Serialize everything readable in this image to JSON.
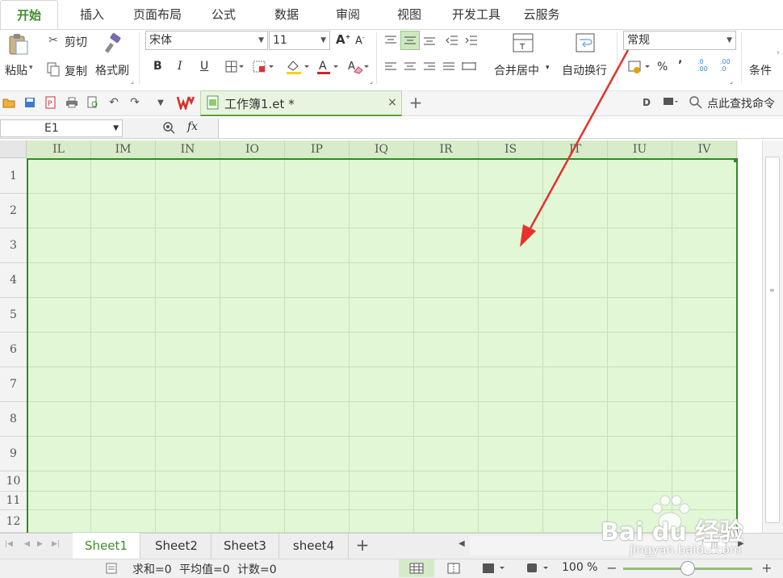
{
  "ribbon_tabs": [
    {
      "label": "开始"
    },
    {
      "label": "插入"
    },
    {
      "label": "页面布局"
    },
    {
      "label": "公式"
    },
    {
      "label": "数据"
    },
    {
      "label": "审阅"
    },
    {
      "label": "视图"
    },
    {
      "label": "开发工具"
    },
    {
      "label": "云服务"
    }
  ],
  "clipboard": {
    "paste": "粘贴",
    "cut": "剪切",
    "copy": "复制",
    "format_painter": "格式刷"
  },
  "font": {
    "name": "宋体",
    "size": "11",
    "bold": "B",
    "italic": "I",
    "underline": "U",
    "font_color_glyph": "A",
    "grow": "A",
    "shrink": "A"
  },
  "alignment": {
    "merge_center": "合并居中",
    "wrap_text": "自动换行"
  },
  "number": {
    "format": "常规",
    "percent": "%",
    "comma": "’",
    "inc_decimal": ".0\n.00",
    "dec_decimal": ".00\n.0"
  },
  "styles": {
    "conditional": "条件"
  },
  "document_tab": {
    "title": "工作簿1.et *"
  },
  "search_command": "点此查找命令",
  "formula_bar": {
    "name_box": "E1",
    "fx": "fx",
    "value": ""
  },
  "columns": [
    "IL",
    "IM",
    "IN",
    "IO",
    "IP",
    "IQ",
    "IR",
    "IS",
    "IT",
    "IU",
    "IV"
  ],
  "rows": [
    "1",
    "2",
    "3",
    "4",
    "5",
    "6",
    "7",
    "8",
    "9",
    "10",
    "11",
    "12"
  ],
  "sheets": [
    {
      "label": "Sheet1"
    },
    {
      "label": "Sheet2"
    },
    {
      "label": "Sheet3"
    },
    {
      "label": "sheet4"
    }
  ],
  "status": {
    "sum": "求和=0",
    "average": "平均值=0",
    "count": "计数=0",
    "zoom": "100 %"
  },
  "watermark": {
    "brand": "Bai du 经验",
    "url": "jingyan.baidu.com"
  },
  "zoom_fraction": 0.5,
  "colors": {
    "accent": "#3f8c2c",
    "grid_fill": "#e2f7d6",
    "selection_border": "#2e8b22",
    "arrow": "#e5322d"
  }
}
